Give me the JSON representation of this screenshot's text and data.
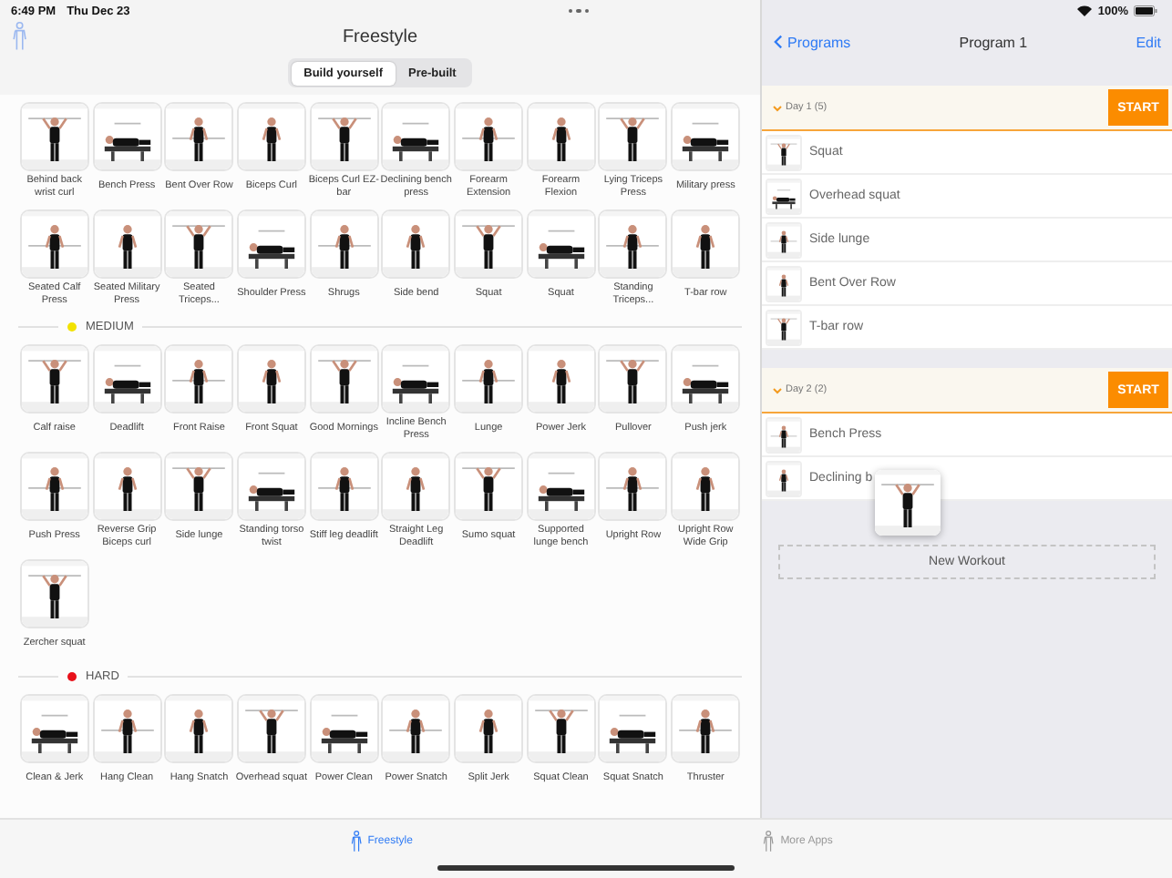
{
  "status_bar": {
    "time": "6:49 PM",
    "date": "Thu Dec 23",
    "battery": "100%"
  },
  "freestyle": {
    "title": "Freestyle",
    "segments": [
      {
        "label": "Build yourself",
        "selected": true
      },
      {
        "label": "Pre-built",
        "selected": false
      }
    ],
    "sections": [
      {
        "exercises": [
          "Behind back wrist curl",
          "Bench Press",
          "Bent Over Row",
          "Biceps Curl",
          "Biceps Curl EZ-bar",
          "Declining bench press",
          "Forearm Extension",
          "Forearm Flexion",
          "Lying Triceps Press",
          "Military press",
          "Seated Calf Press",
          "Seated Military Press",
          "Seated Triceps...",
          "Shoulder Press",
          "Shrugs",
          "Side bend",
          "Squat",
          "Squat",
          "Standing Triceps...",
          "T-bar row"
        ]
      },
      {
        "title": "MEDIUM",
        "color": "#f2e200",
        "exercises": [
          "Calf raise",
          "Deadlift",
          "Front Raise",
          "Front Squat",
          "Good Mornings",
          "Incline Bench Press",
          "Lunge",
          "Power Jerk",
          "Pullover",
          "Push jerk",
          "Push Press",
          "Reverse Grip Biceps curl",
          "Side lunge",
          "Standing torso twist",
          "Stiff leg deadlift",
          "Straight Leg Deadlift",
          "Sumo squat",
          "Supported lunge bench",
          "Upright Row",
          "Upright Row Wide Grip",
          "Zercher squat"
        ]
      },
      {
        "title": "HARD",
        "color": "#e8101a",
        "exercises": [
          "Clean & Jerk",
          "Hang Clean",
          "Hang Snatch",
          "Overhead squat",
          "Power Clean",
          "Power Snatch",
          "Split Jerk",
          "Squat Clean",
          "Squat Snatch",
          "Thruster"
        ]
      }
    ]
  },
  "program": {
    "back": "Programs",
    "title": "Program 1",
    "edit": "Edit",
    "days": [
      {
        "title": "Day 1 (5)",
        "expanded": true,
        "start": "START",
        "exercises": [
          "Squat",
          "Overhead squat",
          "Side lunge",
          "Bent Over Row",
          "T-bar row"
        ]
      },
      {
        "title": "Day 2 (2)",
        "expanded": true,
        "start": "START",
        "exercises": [
          "Bench Press",
          "Declining b"
        ]
      }
    ],
    "new_workout": "New Workout"
  },
  "tab_bar": [
    {
      "label": "Freestyle",
      "selected": true
    },
    {
      "label": "More Apps",
      "selected": false
    }
  ]
}
